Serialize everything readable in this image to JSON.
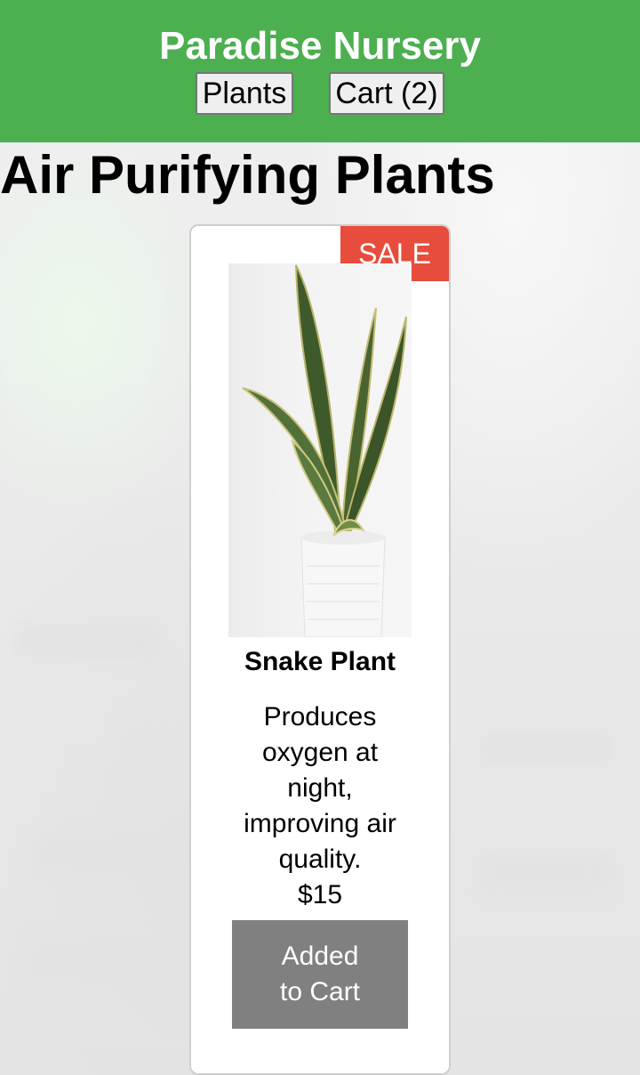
{
  "header": {
    "title": "Paradise Nursery",
    "nav": {
      "plants_label": "Plants",
      "cart_label": "Cart (2)"
    },
    "color": "#4caf50"
  },
  "section": {
    "title": "Air Purifying Plants"
  },
  "product": {
    "badge": "SALE",
    "name": "Snake Plant",
    "description": "Produces oxygen at night, improving air quality.",
    "price": "$15",
    "button_label": "Added to Cart",
    "image_alt": "snake plant in white pot",
    "badge_color": "#e74c3c",
    "button_color": "#808080"
  }
}
